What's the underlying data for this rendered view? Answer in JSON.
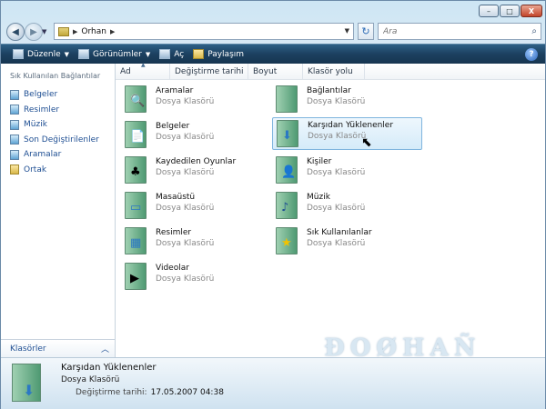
{
  "window": {
    "controls": {
      "minimize": "–",
      "maximize": "□",
      "close": "X"
    }
  },
  "address": {
    "back_icon": "back-arrow-icon",
    "forward_icon": "forward-arrow-icon",
    "path": "Orhan",
    "search_placeholder": "Ara"
  },
  "toolbar": {
    "organize": "Düzenle",
    "views": "Görünümler",
    "open": "Aç",
    "share": "Paylaşım",
    "help": "?"
  },
  "sidebar": {
    "heading": "Sık Kullanılan Bağlantılar",
    "items": [
      {
        "label": "Belgeler",
        "icon": "documents-icon"
      },
      {
        "label": "Resimler",
        "icon": "pictures-icon"
      },
      {
        "label": "Müzik",
        "icon": "music-icon"
      },
      {
        "label": "Son Değiştirilenler",
        "icon": "recent-icon"
      },
      {
        "label": "Aramalar",
        "icon": "searches-icon"
      },
      {
        "label": "Ortak",
        "icon": "public-icon"
      }
    ],
    "folders_label": "Klasörler"
  },
  "columns": [
    "Ad",
    "Değiştirme tarihi",
    "Boyut",
    "Klasör yolu"
  ],
  "folders": [
    {
      "name": "Aramalar",
      "type": "Dosya Klasörü",
      "glyph": "🔍"
    },
    {
      "name": "Bağlantılar",
      "type": "Dosya Klasörü",
      "glyph": ""
    },
    {
      "name": "Belgeler",
      "type": "Dosya Klasörü",
      "glyph": "📄"
    },
    {
      "name": "Karşıdan Yüklenenler",
      "type": "Dosya Klasörü",
      "glyph": "⬇"
    },
    {
      "name": "Kaydedilen Oyunlar",
      "type": "Dosya Klasörü",
      "glyph": "♣"
    },
    {
      "name": "Kişiler",
      "type": "Dosya Klasörü",
      "glyph": "👤"
    },
    {
      "name": "Masaüstü",
      "type": "Dosya Klasörü",
      "glyph": "▭"
    },
    {
      "name": "Müzik",
      "type": "Dosya Klasörü",
      "glyph": "♪"
    },
    {
      "name": "Resimler",
      "type": "Dosya Klasörü",
      "glyph": "▦"
    },
    {
      "name": "Sık Kullanılanlar",
      "type": "Dosya Klasörü",
      "glyph": "★"
    },
    {
      "name": "Videolar",
      "type": "Dosya Klasörü",
      "glyph": "▶"
    }
  ],
  "selected_index": 3,
  "details": {
    "name": "Karşıdan Yüklenenler",
    "type": "Dosya Klasörü",
    "modified_label": "Değiştirme tarihi:",
    "modified_value": "17.05.2007 04:38"
  },
  "watermark": "ĐOØHAÑ",
  "colors": {
    "toolbar": "#1c4060",
    "link": "#1f4f93",
    "selection": "#d5ebf9"
  }
}
